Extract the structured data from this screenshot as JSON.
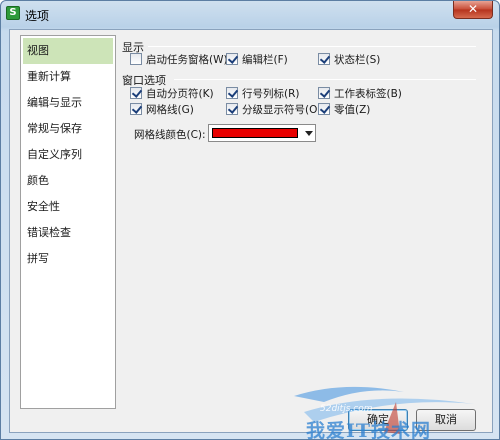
{
  "window": {
    "title": "选项",
    "app_icon_glyph": "S",
    "close_glyph": "✕"
  },
  "sidebar": {
    "items": [
      {
        "label": "视图",
        "selected": true
      },
      {
        "label": "重新计算"
      },
      {
        "label": "编辑与显示"
      },
      {
        "label": "常规与保存"
      },
      {
        "label": "自定义序列"
      },
      {
        "label": "颜色"
      },
      {
        "label": "安全性"
      },
      {
        "label": "错误检查"
      },
      {
        "label": "拼写"
      }
    ]
  },
  "display": {
    "heading": "显示",
    "startup_task_pane": {
      "label": "启动任务窗格",
      "key": "(W)",
      "checked": false
    },
    "formula_bar": {
      "label": "编辑栏",
      "key": "(F)",
      "checked": true
    },
    "status_bar": {
      "label": "状态栏",
      "key": "(S)",
      "checked": true
    }
  },
  "window_options": {
    "heading": "窗口选项",
    "auto_page_break": {
      "label": "自动分页符",
      "key": "(K)",
      "checked": true
    },
    "row_col_headers": {
      "label": "行号列标",
      "key": "(R)",
      "checked": true
    },
    "sheet_tabs": {
      "label": "工作表标签",
      "key": "(B)",
      "checked": true
    },
    "gridlines": {
      "label": "网格线",
      "key": "(G)",
      "checked": true
    },
    "outline_symbols": {
      "label": "分级显示符号",
      "key": "(O)",
      "checked": true
    },
    "zero_values": {
      "label": "零值",
      "key": "(Z)",
      "checked": true
    }
  },
  "gridline_color": {
    "label": "网格线颜色",
    "key": "(C):",
    "value_color": "#e80000"
  },
  "buttons": {
    "ok": "确定",
    "cancel": "取消"
  },
  "watermark": {
    "text": "我爱IT技术网",
    "url": "52ditjs.com"
  },
  "colors": {
    "selected_sidebar": "#cde4b8",
    "close_button": "#c74a34",
    "gridline_swatch": "#e80000"
  }
}
